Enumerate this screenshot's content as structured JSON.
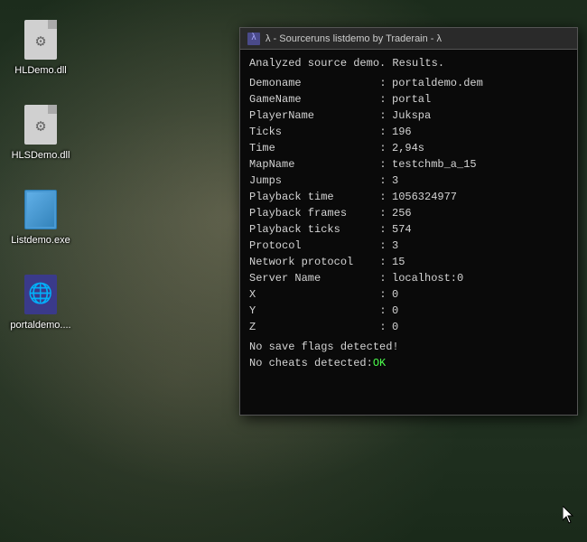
{
  "desktop": {
    "icons": [
      {
        "id": "hldemo-dll",
        "label": "HLDemo.dll",
        "type": "file-gear"
      },
      {
        "id": "hlsdemo-dll",
        "label": "HLSDemo.dll",
        "type": "file-gear"
      },
      {
        "id": "listdemo-exe",
        "label": "Listdemo.exe",
        "type": "exe"
      },
      {
        "id": "portaldemo",
        "label": "portaldemo....",
        "type": "globe"
      }
    ]
  },
  "terminal": {
    "title": "λ - Sourceruns listdemo by Traderain - λ",
    "title_icon": "λ",
    "header": "Analyzed source demo. Results.",
    "rows": [
      {
        "label": "Demoname",
        "value": "portaldemo.dem"
      },
      {
        "label": "GameName",
        "value": "portal"
      },
      {
        "label": "PlayerName",
        "value": "Jukspa"
      },
      {
        "label": "Ticks",
        "value": "196"
      },
      {
        "label": "Time",
        "value": "2,94s"
      },
      {
        "label": "MapName",
        "value": "testchmb_a_15"
      },
      {
        "label": "Jumps",
        "value": "3"
      },
      {
        "label": "Playback time",
        "value": "1056324977"
      },
      {
        "label": "Playback frames",
        "value": "256"
      },
      {
        "label": "Playback ticks",
        "value": "574"
      },
      {
        "label": "Protocol",
        "value": "3"
      },
      {
        "label": "Network protocol",
        "value": "15"
      },
      {
        "label": "Server Name",
        "value": "localhost:0"
      },
      {
        "label": "X",
        "value": "0"
      },
      {
        "label": "Y",
        "value": "0"
      },
      {
        "label": "Z",
        "value": "0"
      }
    ],
    "footer1": "No save flags detected!",
    "footer2_prefix": "No cheats detected: ",
    "footer2_ok": "OK",
    "separator": ":"
  }
}
